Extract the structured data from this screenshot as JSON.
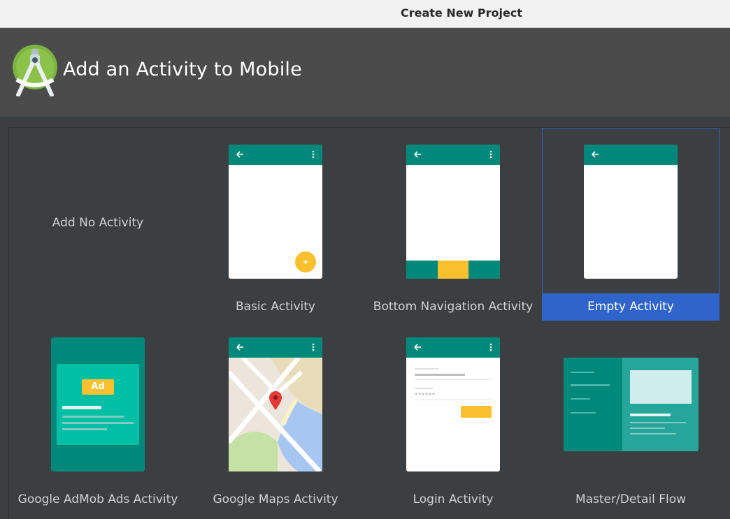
{
  "window": {
    "title": "Create New Project"
  },
  "header": {
    "title": "Add an Activity to Mobile",
    "logo_icon": "android-studio-logo-icon"
  },
  "colors": {
    "teal_dark": "#00897b",
    "teal_light": "#26a69a",
    "amber": "#fbc02d",
    "selection": "#2f65ca",
    "panel": "#3c3f41"
  },
  "templates": [
    {
      "label": "Add No Activity",
      "selected": false
    },
    {
      "label": "Basic Activity",
      "selected": false
    },
    {
      "label": "Bottom Navigation Activity",
      "selected": false
    },
    {
      "label": "Empty Activity",
      "selected": true
    },
    {
      "label": "Google AdMob Ads Activity",
      "selected": false,
      "badge": "Ad"
    },
    {
      "label": "Google Maps Activity",
      "selected": false
    },
    {
      "label": "Login Activity",
      "selected": false
    },
    {
      "label": "Master/Detail Flow",
      "selected": false
    }
  ]
}
